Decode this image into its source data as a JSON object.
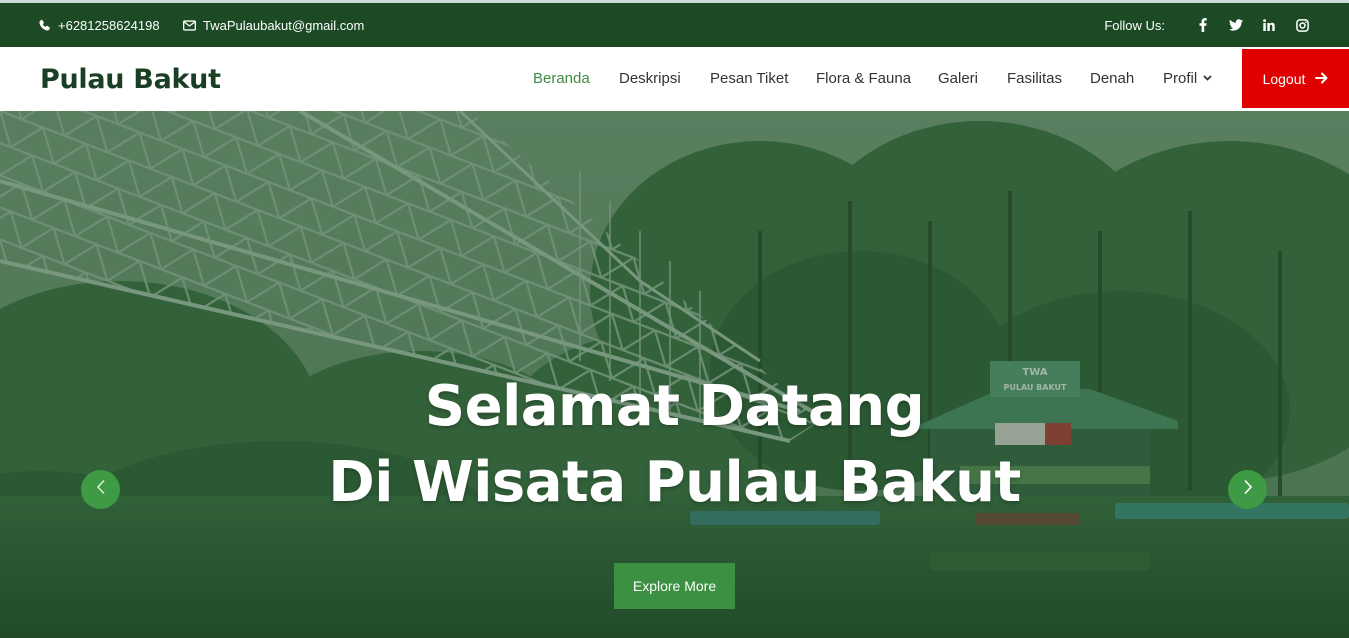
{
  "topbar": {
    "phone": "+6281258624198",
    "email": "TwaPulaubakut@gmail.com",
    "follow_label": "Follow Us:",
    "socials": [
      "facebook-icon",
      "twitter-icon",
      "linkedin-icon",
      "instagram-icon"
    ]
  },
  "navbar": {
    "brand": "Pulau Bakut",
    "items": [
      {
        "label": "Beranda",
        "active": true
      },
      {
        "label": "Deskripsi"
      },
      {
        "label": "Pesan Tiket"
      },
      {
        "label": "Flora & Fauna"
      },
      {
        "label": "Galeri"
      },
      {
        "label": "Fasilitas"
      },
      {
        "label": "Denah"
      },
      {
        "label": "Profil",
        "has_dropdown": true
      }
    ],
    "logout_label": "Logout"
  },
  "hero": {
    "title_line1": "Selamat Datang",
    "title_line2": "Di Wisata Pulau Bakut",
    "cta_label": "Explore More",
    "sign_text_1": "TWA",
    "sign_text_2": "PULAU BAKUT"
  },
  "colors": {
    "topbar_bg": "#1b4a25",
    "brand": "#1b3f24",
    "active_link": "#3f8a44",
    "logout_bg": "#e00000",
    "cta_bg": "#3b9141",
    "carousel_arrow_bg": "#3e9a44"
  }
}
